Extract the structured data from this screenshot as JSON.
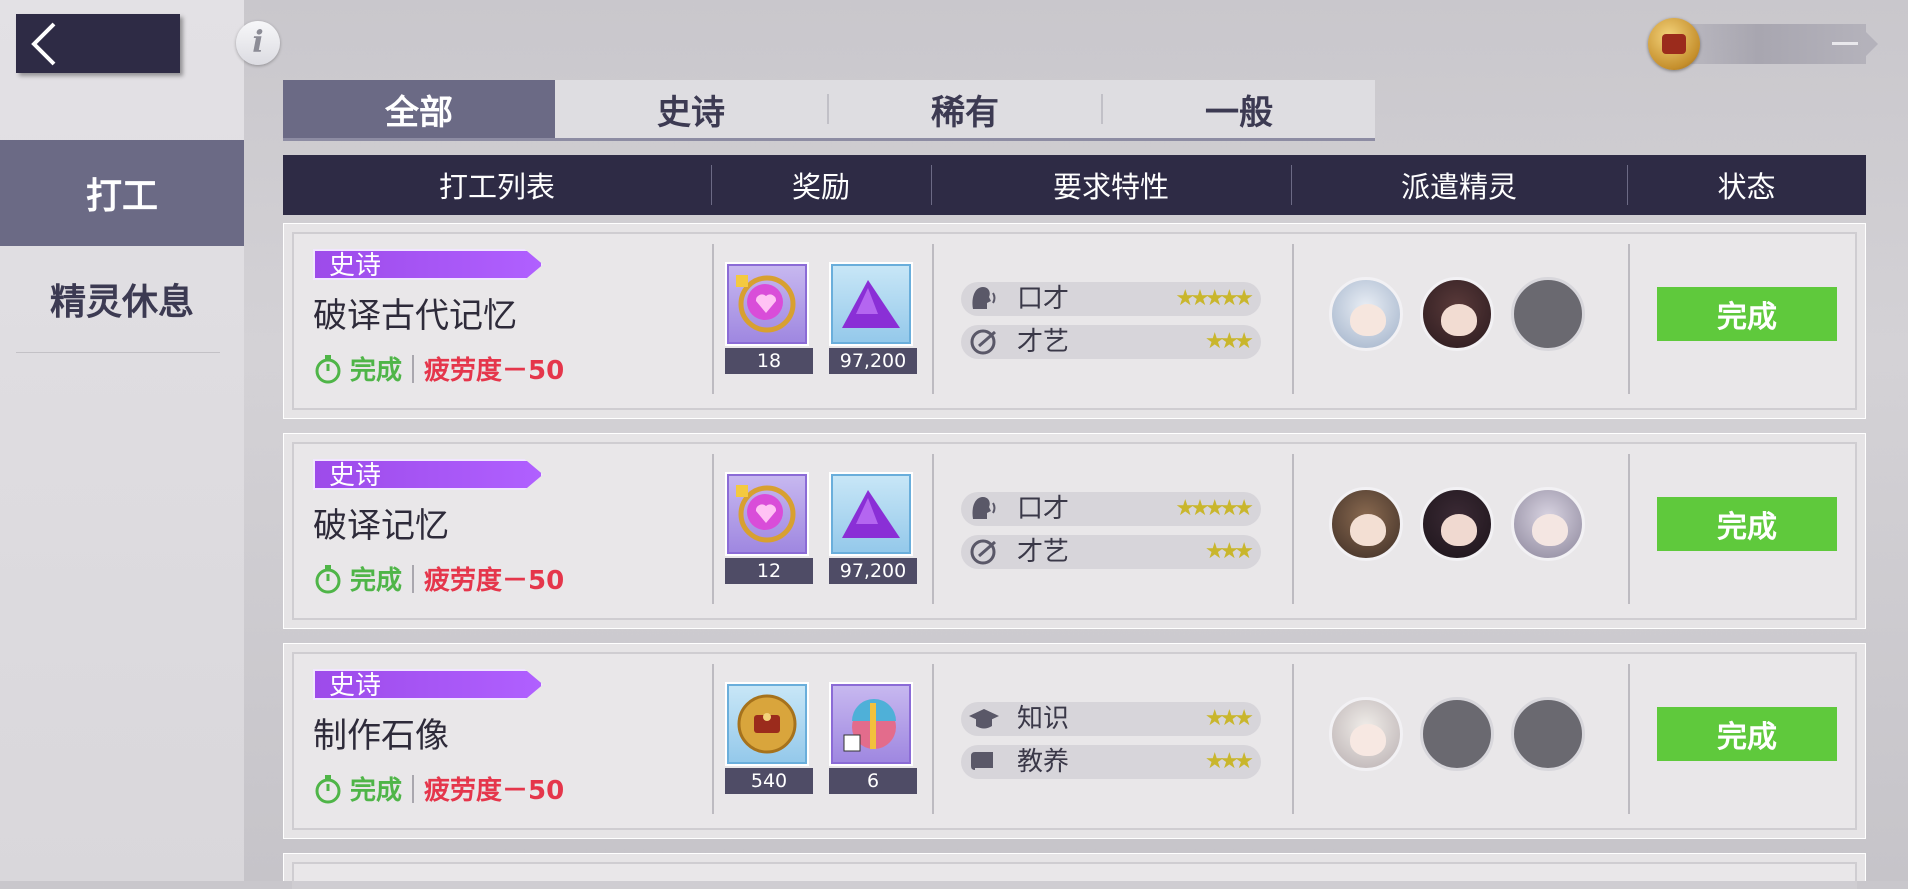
{
  "nav": {
    "back_icon": "chevron-left-icon",
    "info_icon": "i",
    "sidebar": [
      {
        "label": "打工",
        "active": true
      },
      {
        "label": "精灵休息",
        "active": false
      }
    ]
  },
  "tabs": [
    {
      "label": "全部",
      "active": true
    },
    {
      "label": "史诗",
      "active": false
    },
    {
      "label": "稀有",
      "active": false
    },
    {
      "label": "一般",
      "active": false
    }
  ],
  "table": {
    "headers": [
      "打工列表",
      "奖励",
      "要求特性",
      "派遣精灵",
      "状态"
    ]
  },
  "colors": {
    "accent_dark": "#2e2b45",
    "tab_active": "#6b6a85",
    "epic_purple": "#9d4bea",
    "complete_green": "#5fc93c",
    "fatigue_red": "#e5364b"
  },
  "rows": [
    {
      "rarity": "史诗",
      "name": "破译古代记忆",
      "status_text": "完成",
      "fatigue": "疲劳度－50",
      "rewards": [
        {
          "icon": "heart-compass-icon",
          "qty": "18"
        },
        {
          "icon": "purple-crystal-pile-icon",
          "qty": "97,200"
        }
      ],
      "traits": [
        {
          "icon": "speaking-head-icon",
          "name": "口才",
          "stars": "★★★★★"
        },
        {
          "icon": "palette-icon",
          "name": "才艺",
          "stars": "★★★"
        }
      ],
      "spirits": [
        "spirit-white-hair",
        "spirit-dark-hair",
        "empty"
      ],
      "button": "完成"
    },
    {
      "rarity": "史诗",
      "name": "破译记忆",
      "status_text": "完成",
      "fatigue": "疲劳度－50",
      "rewards": [
        {
          "icon": "heart-compass-icon",
          "qty": "12"
        },
        {
          "icon": "purple-crystal-pile-icon",
          "qty": "97,200"
        }
      ],
      "traits": [
        {
          "icon": "speaking-head-icon",
          "name": "口才",
          "stars": "★★★★★"
        },
        {
          "icon": "palette-icon",
          "name": "才艺",
          "stars": "★★★"
        }
      ],
      "spirits": [
        "spirit-brown-hair",
        "spirit-black-hair",
        "spirit-silver-hair"
      ],
      "button": "完成"
    },
    {
      "rarity": "史诗",
      "name": "制作石像",
      "status_text": "完成",
      "fatigue": "疲劳度－50",
      "rewards": [
        {
          "icon": "gold-coin-icon",
          "qty": "540"
        },
        {
          "icon": "gift-box-icon",
          "qty": "6"
        }
      ],
      "traits": [
        {
          "icon": "graduation-cap-icon",
          "name": "知识",
          "stars": "★★★"
        },
        {
          "icon": "book-icon",
          "name": "教养",
          "stars": "★★★"
        }
      ],
      "spirits": [
        "spirit-white-hair-2",
        "empty",
        "empty"
      ],
      "button": "完成"
    }
  ]
}
